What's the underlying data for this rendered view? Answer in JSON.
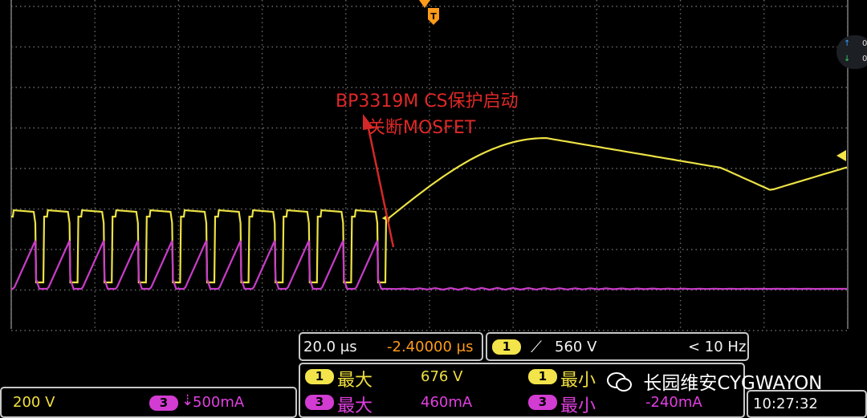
{
  "annotation": {
    "line1": "BP3319M CS保护启动",
    "line2": "关断MOSFET"
  },
  "timebase": {
    "time_per_div": "20.0 μs",
    "trigger_delay": "-2.40000 μs"
  },
  "trigger": {
    "channel": "1",
    "slope_icon": "rising-edge-icon",
    "level": "560 V",
    "frequency": "< 10 Hz"
  },
  "channel1": {
    "number": "1",
    "scale": "200 V",
    "color": "#f0e040"
  },
  "channel3": {
    "number": "3",
    "scale": "500mA",
    "color": "#e040e0"
  },
  "measurements": [
    {
      "channel": "1",
      "label": "最大",
      "value": "676 V",
      "color": "#f0e040"
    },
    {
      "channel": "1",
      "label": "最小",
      "value": "",
      "color": "#f0e040"
    },
    {
      "channel": "3",
      "label": "最大",
      "value": "460mA",
      "color": "#e040e0"
    },
    {
      "channel": "3",
      "label": "最小",
      "value": "-240mA",
      "color": "#e040e0"
    }
  ],
  "watermark": "长园维安CYGWAYON",
  "clock": "10:27:32",
  "side_panel": {
    "up_value": "0",
    "down_value": "0"
  }
}
